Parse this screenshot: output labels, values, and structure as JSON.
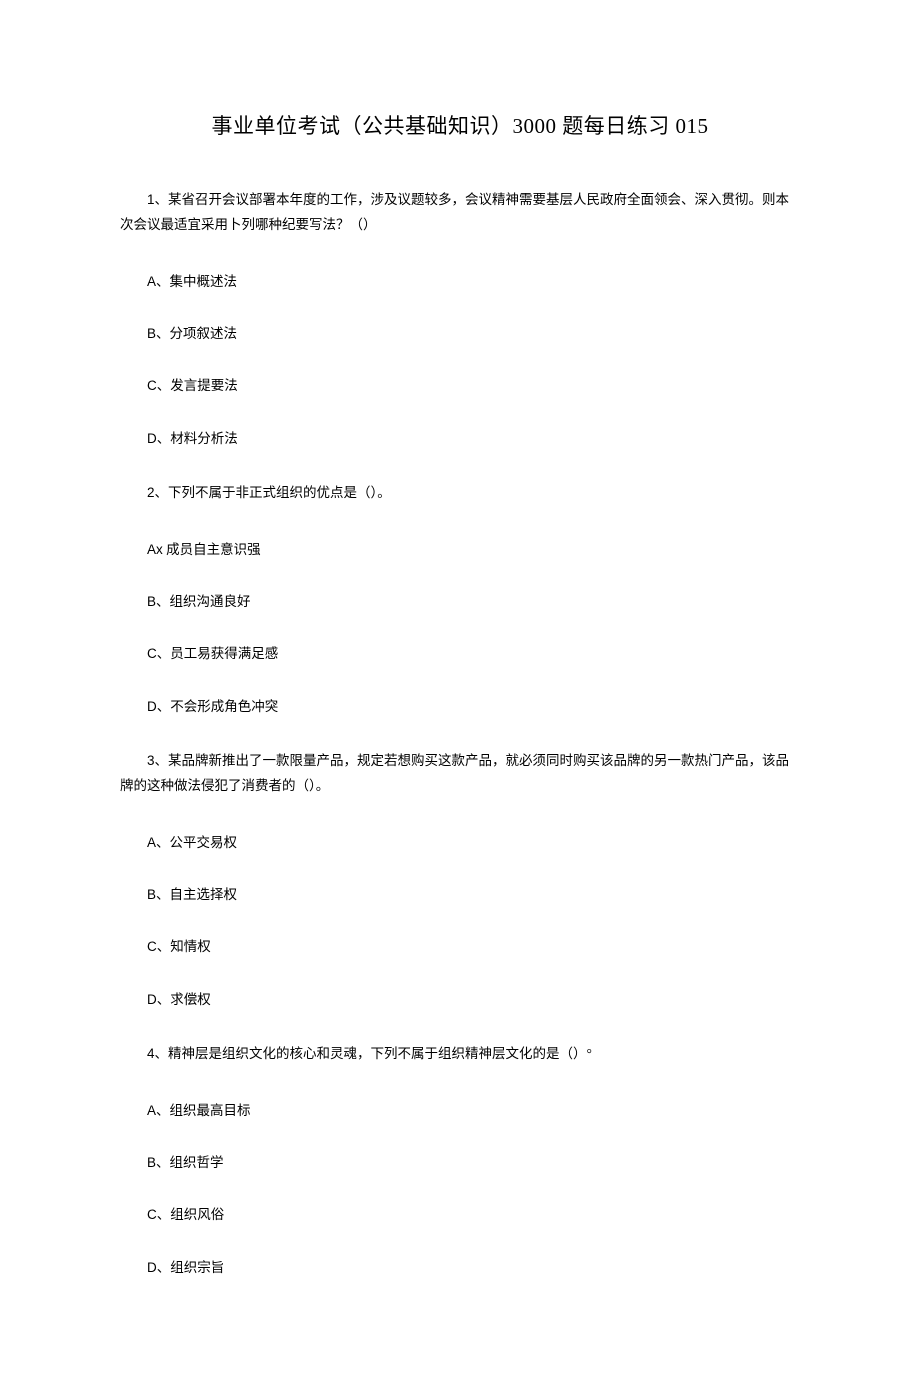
{
  "title_prefix": "事业单位考试（公共基础知识）",
  "title_number": "3000",
  "title_suffix": "题每日练习",
  "title_code": "015",
  "questions": [
    {
      "num": "1",
      "stem": "、某省召开会议部署本年度的工作，涉及议题较多，会议精神需要基层人民政府全面领会、深入贯彻。则本次会议最适宜采用卜列哪种纪要写法？（）",
      "opts": [
        {
          "label": "A",
          "sep": "、",
          "text": "集中概述法"
        },
        {
          "label": "B",
          "sep": "、",
          "text": "分项叙述法"
        },
        {
          "label": "C",
          "sep": "、",
          "text": "发言提要法"
        },
        {
          "label": "D",
          "sep": "、",
          "text": "材料分析法"
        }
      ]
    },
    {
      "num": "2",
      "stem": "、下列不属于非正式组织的优点是（）。",
      "opts": [
        {
          "label": "Ax",
          "sep": "",
          "text": " 成员自主意识强"
        },
        {
          "label": "B",
          "sep": "、",
          "text": "组织沟通良好"
        },
        {
          "label": "C",
          "sep": "、",
          "text": "员工易获得满足感"
        },
        {
          "label": "D",
          "sep": "、",
          "text": "不会形成角色冲突"
        }
      ]
    },
    {
      "num": "3",
      "stem": "、某品牌新推出了一款限量产品，规定若想购买这款产品，就必须同时购买该品牌的另一款热门产品，该品牌的这种做法侵犯了消费者的（）。",
      "opts": [
        {
          "label": "A",
          "sep": "、",
          "text": "公平交易权"
        },
        {
          "label": "B",
          "sep": "、",
          "text": "自主选择权"
        },
        {
          "label": "C",
          "sep": "、",
          "text": "知情权"
        },
        {
          "label": "D",
          "sep": "、",
          "text": "求偿权"
        }
      ]
    },
    {
      "num": "4",
      "stem": "、精神层是组织文化的核心和灵魂，下列不属于组织精神层文化的是（）°",
      "opts": [
        {
          "label": "A",
          "sep": "、",
          "text": "组织最高目标"
        },
        {
          "label": "B",
          "sep": "、",
          "text": "组织哲学"
        },
        {
          "label": "C",
          "sep": "、",
          "text": "组织风俗"
        },
        {
          "label": "D",
          "sep": "、",
          "text": "组织宗旨"
        }
      ]
    }
  ]
}
